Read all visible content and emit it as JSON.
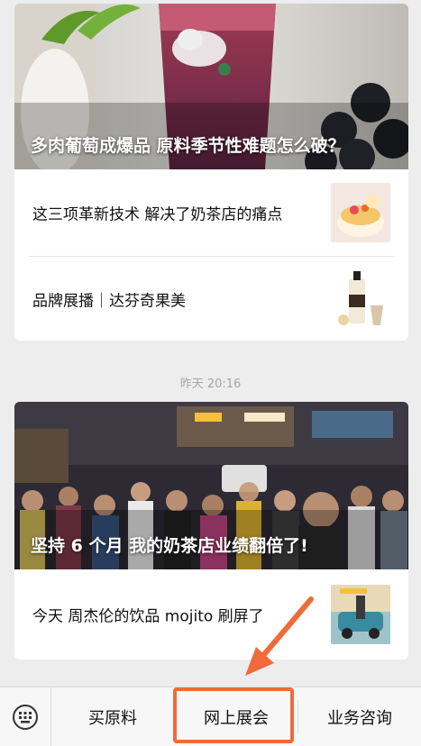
{
  "article_group_1": {
    "hero_title": "多肉葡萄成爆品 原料季节性难题怎么破？",
    "items": [
      {
        "title": "这三项革新技术 解决了奶茶店的痛点"
      },
      {
        "title": "品牌展播｜达芬奇果美"
      }
    ]
  },
  "timestamp": "昨天 20:16",
  "article_group_2": {
    "hero_title": "坚持 6 个月 我的奶茶店业绩翻倍了!",
    "items": [
      {
        "title": "今天 周杰伦的饮品 mojito 刷屏了"
      }
    ]
  },
  "bottom_menu": {
    "items": [
      {
        "label": "买原料"
      },
      {
        "label": "网上展会"
      },
      {
        "label": "业务咨询"
      }
    ]
  },
  "colors": {
    "highlight": "#f06a3a",
    "background": "#ededed"
  }
}
